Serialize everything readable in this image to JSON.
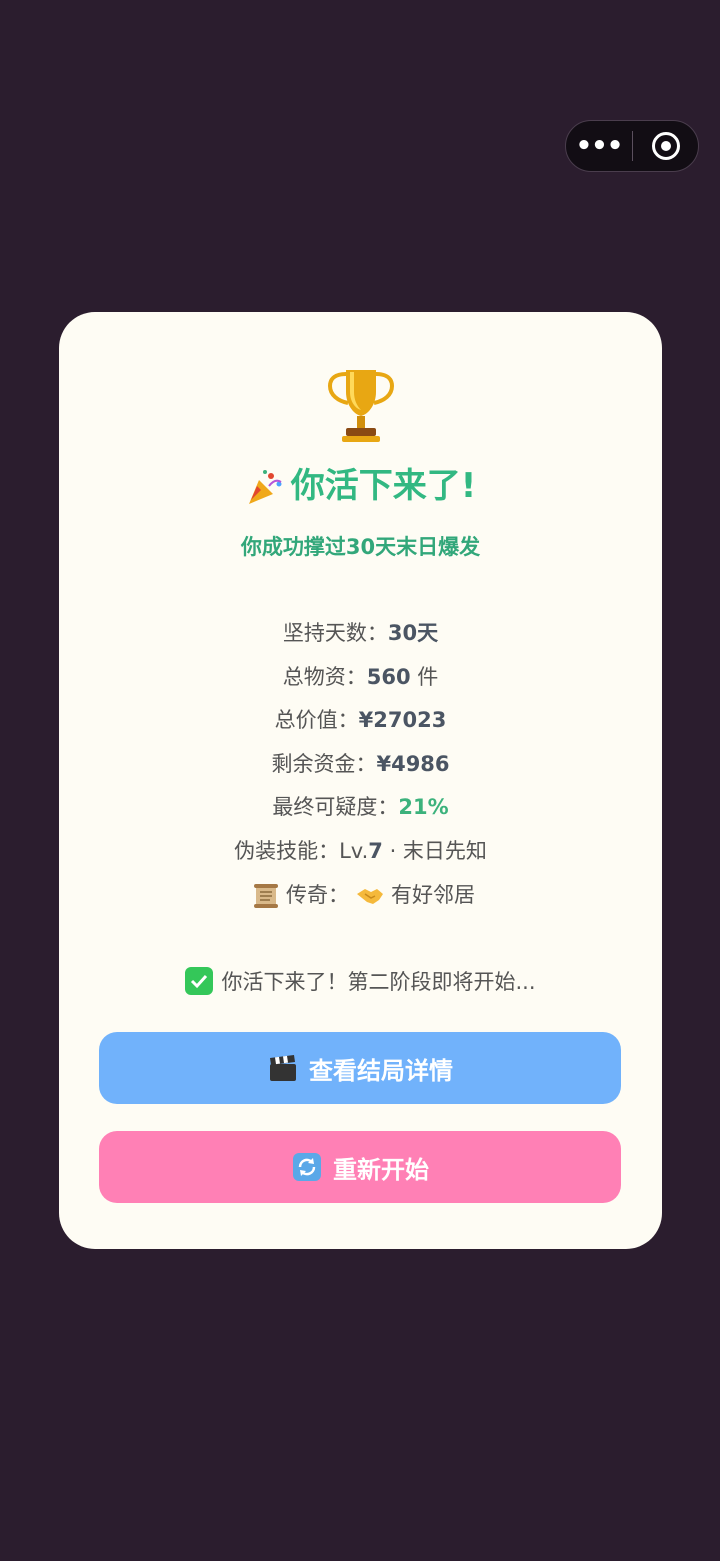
{
  "window": {
    "more_label": "•••"
  },
  "result": {
    "title": "你活下来了!",
    "subtitle": "你成功撑过30天末日爆发"
  },
  "stats": {
    "days_label": "坚持天数：",
    "days_value": "30天",
    "supplies_label": "总物资：",
    "supplies_value": "560",
    "supplies_unit": " 件",
    "total_value_label": "总价值：",
    "total_value_value": "¥27023",
    "funds_label": "剩余资金：",
    "funds_value": "¥4986",
    "suspicion_label": "最终可疑度：",
    "suspicion_value": "21%",
    "skill_label": "伪装技能：",
    "skill_prefix": "Lv.",
    "skill_level": "7",
    "skill_suffix": " · 末日先知",
    "legend_label": "传奇：",
    "legend_value": "有好邻居"
  },
  "notice": {
    "text": "你活下来了！第二阶段即将开始..."
  },
  "buttons": {
    "details_label": "查看结局详情",
    "restart_label": "重新开始"
  },
  "colors": {
    "background": "#2b1d2e",
    "card": "#fefcf4",
    "accent_green": "#32b882",
    "button_blue": "#71b2fb",
    "button_pink": "#ff80b5"
  },
  "icons": [
    "trophy-icon",
    "party-popper-icon",
    "scroll-icon",
    "handshake-icon",
    "check-icon",
    "clapper-icon",
    "refresh-icon",
    "more-icon",
    "close-target-icon"
  ]
}
